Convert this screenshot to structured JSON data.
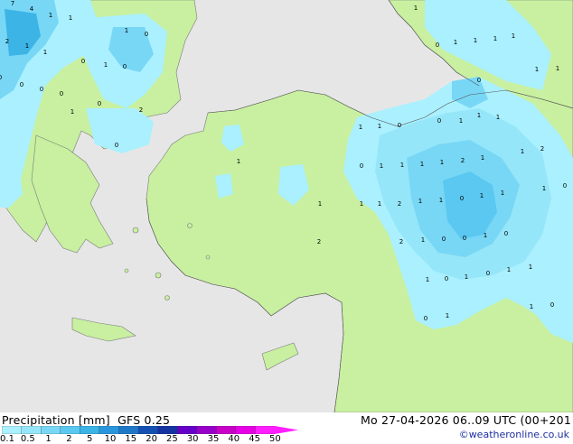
{
  "legend": {
    "title": "Precipitation [mm]",
    "model": "GFS 0.25",
    "datetime": "Mo 27-04-2026 06..09 UTC (00+201",
    "credit": "©weatheronline.co.uk",
    "ticks": [
      "0.1",
      "0.5",
      "1",
      "2",
      "5",
      "10",
      "15",
      "20",
      "25",
      "30",
      "35",
      "40",
      "45",
      "50"
    ],
    "colors": [
      "#aaf0ff",
      "#96e6fa",
      "#78d7f5",
      "#5ac8f0",
      "#3cb4e6",
      "#2896dc",
      "#1e78c8",
      "#1450b4",
      "#1432a0",
      "#6400c8",
      "#9600c8",
      "#c800c8",
      "#e600e6",
      "#ff1eff"
    ]
  },
  "map": {
    "land_color": "#c8f0a0",
    "sea_color": "#e6e6e6",
    "values": [
      "7",
      "4",
      "1",
      "1",
      "2",
      "1",
      "1",
      "0",
      "1",
      "0",
      "1",
      "0",
      "0",
      "0",
      "0",
      "0",
      "0",
      "1",
      "2",
      "0",
      "1",
      "1",
      "0",
      "1",
      "1",
      "1",
      "1",
      "1",
      "1",
      "0",
      "0",
      "1",
      "1",
      "1",
      "1",
      "1",
      "0",
      "0",
      "1",
      "1",
      "1",
      "1",
      "2",
      "1",
      "1",
      "2",
      "1",
      "2",
      "1",
      "1",
      "0",
      "1",
      "1",
      "1",
      "0",
      "1",
      "1",
      "2",
      "2",
      "1",
      "0",
      "0",
      "1",
      "0",
      "1",
      "0",
      "1",
      "0",
      "1",
      "1",
      "0",
      "1",
      "1",
      "0"
    ]
  }
}
